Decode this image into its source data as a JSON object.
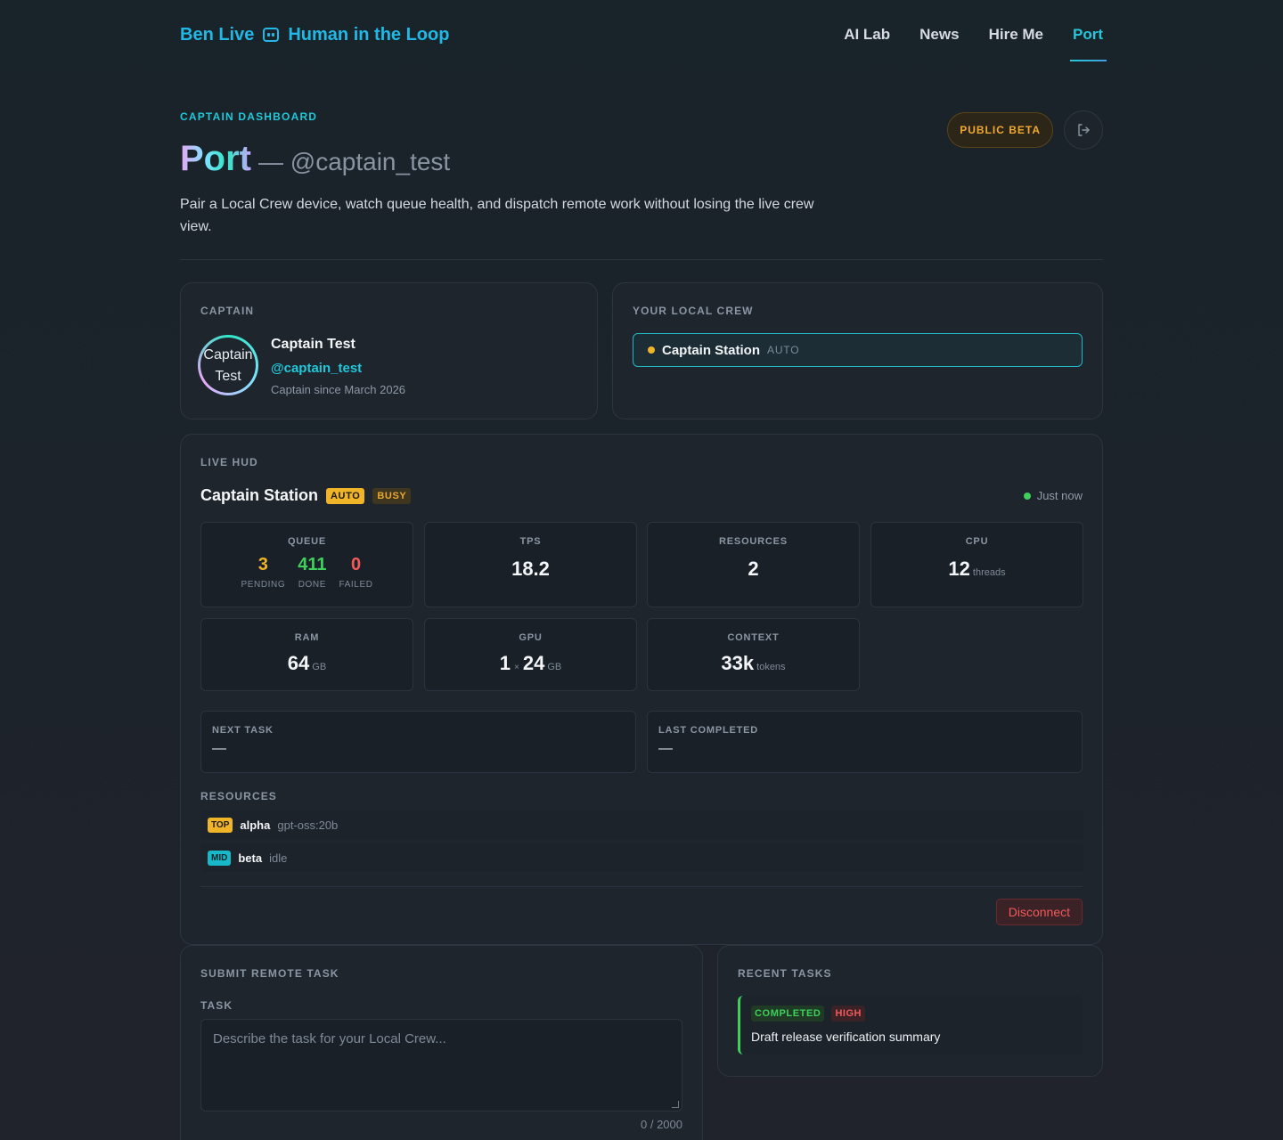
{
  "brand": {
    "name": "Ben Live",
    "tagline": "Human in the Loop"
  },
  "nav": [
    {
      "label": "AI Lab"
    },
    {
      "label": "News"
    },
    {
      "label": "Hire Me"
    },
    {
      "label": "Port",
      "active": true
    }
  ],
  "hero": {
    "eyebrow": "CAPTAIN DASHBOARD",
    "title": "Port",
    "subtitle": "— @captain_test",
    "description": "Pair a Local Crew device, watch queue health, and dispatch remote work without losing the live crew view.",
    "badge": "PUBLIC BETA",
    "logout_icon": "logout-icon"
  },
  "captain": {
    "label": "CAPTAIN",
    "avatar_alt": "Captain Test",
    "name": "Captain Test",
    "handle": "@captain_test",
    "since": "Captain since March 2026"
  },
  "crew": {
    "label": "YOUR LOCAL CREW",
    "device": {
      "name": "Captain Station",
      "mode": "AUTO",
      "status_color": "#f0b429"
    }
  },
  "hud": {
    "label": "LIVE HUD",
    "station": "Captain Station",
    "mode_badge": "AUTO",
    "state_badge": "BUSY",
    "last_seen": "Just now",
    "queue": {
      "label": "QUEUE",
      "pending": "3",
      "pending_label": "PENDING",
      "done": "411",
      "done_label": "DONE",
      "failed": "0",
      "failed_label": "FAILED"
    },
    "tps": {
      "label": "TPS",
      "value": "18.2"
    },
    "resources_count": {
      "label": "RESOURCES",
      "value": "2"
    },
    "cpu": {
      "label": "CPU",
      "value": "12",
      "unit": "threads"
    },
    "ram": {
      "label": "RAM",
      "value": "64",
      "unit": "GB"
    },
    "gpu": {
      "label": "GPU",
      "count": "1",
      "times": "×",
      "value": "24",
      "unit": "GB"
    },
    "context": {
      "label": "CONTEXT",
      "value": "33k",
      "unit": "tokens"
    },
    "next_task": {
      "label": "NEXT TASK",
      "value": "—"
    },
    "last_completed": {
      "label": "LAST COMPLETED",
      "value": "—"
    },
    "resources_label": "RESOURCES",
    "resources": [
      {
        "tier": "TOP",
        "name": "alpha",
        "meta": "gpt-oss:20b"
      },
      {
        "tier": "MID",
        "name": "beta",
        "meta": "idle"
      }
    ],
    "disconnect": "Disconnect"
  },
  "submit": {
    "label": "SUBMIT REMOTE TASK",
    "field_label": "TASK",
    "placeholder": "Describe the task for your Local Crew...",
    "counter": "0 / 2000"
  },
  "recent": {
    "label": "RECENT TASKS",
    "items": [
      {
        "status": "COMPLETED",
        "priority": "HIGH",
        "title": "Draft release verification summary"
      }
    ]
  }
}
